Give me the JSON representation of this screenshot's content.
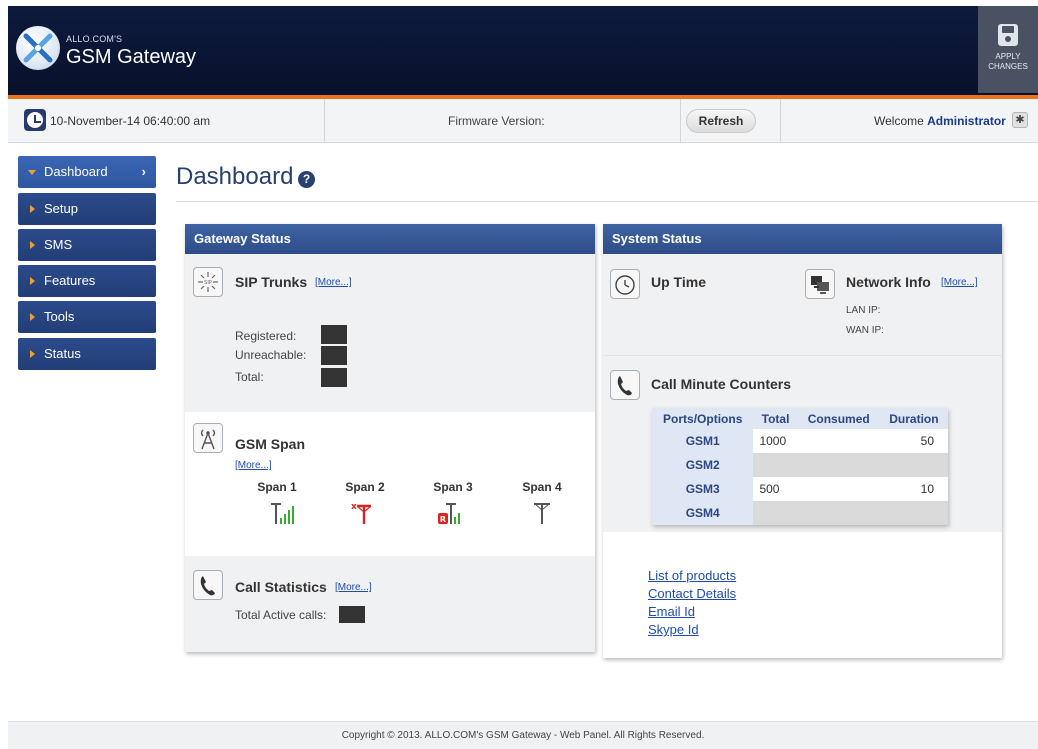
{
  "header": {
    "brand_small": "ALLO.COM'S",
    "brand_title": "GSM Gateway",
    "apply_label_1": "APPLY",
    "apply_label_2": "CHANGES"
  },
  "infobar": {
    "datetime": "10-November-14  06:40:00 am",
    "firmware_label": "Firmware Version:",
    "refresh_label": "Refresh",
    "welcome_prefix": "Welcome",
    "user": "Administrator"
  },
  "sidebar": {
    "items": [
      {
        "label": "Dashboard",
        "active": true
      },
      {
        "label": "Setup"
      },
      {
        "label": "SMS"
      },
      {
        "label": "Features"
      },
      {
        "label": "Tools"
      },
      {
        "label": "Status"
      }
    ]
  },
  "page": {
    "title": "Dashboard",
    "help": "?"
  },
  "gateway": {
    "header": "Gateway Status",
    "sip": {
      "title": "SIP Trunks",
      "more": "[More...]",
      "registered": "Registered:",
      "unreachable": "Unreachable:",
      "total": "Total:"
    },
    "gsm": {
      "title": "GSM Span",
      "more": "[More...]",
      "spans": [
        "Span 1",
        "Span 2",
        "Span 3",
        "Span 4"
      ],
      "span_states": [
        "signal-green",
        "no-signal-red",
        "registered-red",
        "idle"
      ]
    },
    "calls": {
      "title": "Call Statistics",
      "more": "[More...]",
      "active_label": "Total Active calls:"
    }
  },
  "system": {
    "header": "System Status",
    "uptime": {
      "title": "Up Time"
    },
    "network": {
      "title": "Network Info",
      "more": "[More...]",
      "lan": "LAN IP:",
      "wan": "WAN IP:"
    },
    "cmc": {
      "title": "Call Minute Counters",
      "columns": [
        "Ports/Options",
        "Total",
        "Consumed",
        "Duration"
      ],
      "rows": [
        {
          "port": "GSM1",
          "total": "1000",
          "consumed": "",
          "duration": "50"
        },
        {
          "port": "GSM2",
          "total": "",
          "consumed": "",
          "duration": ""
        },
        {
          "port": "GSM3",
          "total": "500",
          "consumed": "",
          "duration": "10"
        },
        {
          "port": "GSM4",
          "total": "",
          "consumed": "",
          "duration": ""
        }
      ]
    },
    "links": [
      "List of products",
      "Contact Details",
      "Email Id",
      "Skype Id"
    ]
  },
  "footer": {
    "text": "Copyright © 2013. ALLO.COM's GSM Gateway - Web Panel. All Rights Reserved."
  },
  "colors": {
    "header_bg": "#0a1533",
    "accent": "#e8741c",
    "nav_bg": "#223e76",
    "panel_head": "#3f63a4",
    "link": "#1f4bb0"
  }
}
